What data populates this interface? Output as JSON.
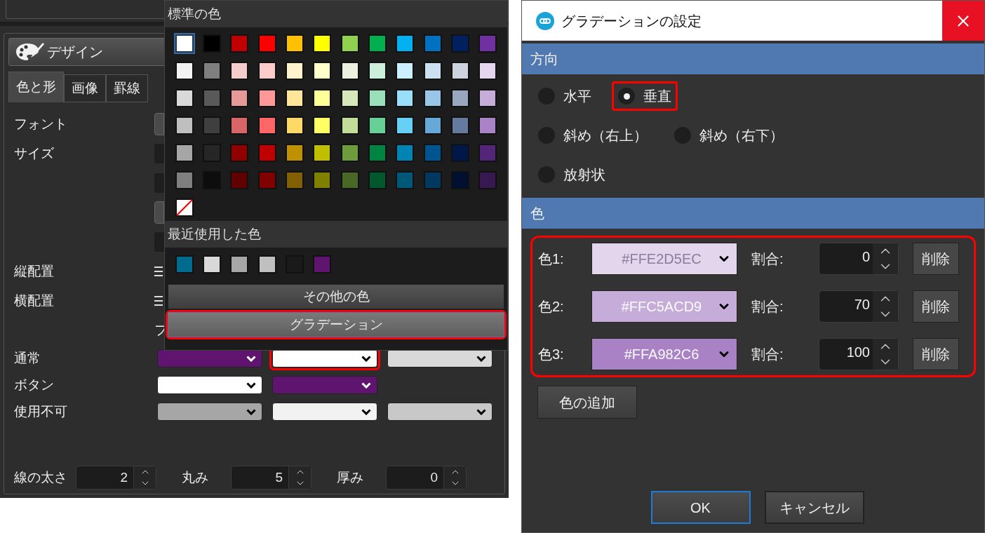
{
  "design_panel": {
    "title": "デザイン",
    "tabs": [
      {
        "label": "色と形",
        "selected": true
      },
      {
        "label": "画像",
        "selected": false
      },
      {
        "label": "罫線",
        "selected": false
      }
    ],
    "property_rows": [
      {
        "label": "フォント",
        "kind": "button-edge"
      },
      {
        "label": "サイズ",
        "kind": "field-edge"
      },
      {
        "kind": "field-edge"
      },
      {
        "kind": "button-edge"
      },
      {
        "kind": "field-edge"
      },
      {
        "label": "縦配置",
        "kind": "align-icon"
      },
      {
        "label": "横配置",
        "kind": "align-icon"
      },
      {
        "kind": "text-edge",
        "text": "フ"
      }
    ],
    "color_rows": [
      {
        "label": "通常",
        "dropdowns": [
          {
            "color": "#5f1470"
          },
          {
            "color": "#ffffff",
            "highlighted": true
          },
          {
            "color": "#d9d9d9"
          }
        ]
      },
      {
        "label": "ボタン",
        "dropdowns": [
          {
            "color": "#ffffff"
          },
          {
            "color": "#5f1470"
          }
        ]
      },
      {
        "label": "使用不可",
        "dropdowns": [
          {
            "color": "#a6a6a6"
          },
          {
            "color": "#f2f2f2"
          },
          {
            "color": "#c8c8c8"
          }
        ]
      }
    ],
    "spinners": [
      {
        "label": "線の太さ",
        "value": "2"
      },
      {
        "label": "丸み",
        "value": "5"
      },
      {
        "label": "厚み",
        "value": "0"
      }
    ]
  },
  "color_popup": {
    "standard_title": "標準の色",
    "swatches": [
      {
        "kind": "color",
        "color": "#ffffff",
        "selected": true
      },
      {
        "kind": "color",
        "color": "#000000",
        "selected": false
      },
      {
        "kind": "color",
        "color": "#c00000",
        "selected": false
      },
      {
        "kind": "color",
        "color": "#ff0000",
        "selected": false
      },
      {
        "kind": "color",
        "color": "#ffc000",
        "selected": false
      },
      {
        "kind": "color",
        "color": "#ffff00",
        "selected": false
      },
      {
        "kind": "color",
        "color": "#92d050",
        "selected": false
      },
      {
        "kind": "color",
        "color": "#00b050",
        "selected": false
      },
      {
        "kind": "color",
        "color": "#00b0f0",
        "selected": false
      },
      {
        "kind": "color",
        "color": "#0070c0",
        "selected": false
      },
      {
        "kind": "color",
        "color": "#002060",
        "selected": false
      },
      {
        "kind": "color",
        "color": "#7030a0",
        "selected": false
      },
      {
        "kind": "color",
        "color": "#f2f2f2",
        "selected": false
      },
      {
        "kind": "color",
        "color": "#7f7f7f",
        "selected": false
      },
      {
        "kind": "color",
        "color": "#f4cccc",
        "selected": false
      },
      {
        "kind": "color",
        "color": "#ffcccc",
        "selected": false
      },
      {
        "kind": "color",
        "color": "#fff2cc",
        "selected": false
      },
      {
        "kind": "color",
        "color": "#ffffcc",
        "selected": false
      },
      {
        "kind": "color",
        "color": "#ebf1de",
        "selected": false
      },
      {
        "kind": "color",
        "color": "#ccefdc",
        "selected": false
      },
      {
        "kind": "color",
        "color": "#ccefff",
        "selected": false
      },
      {
        "kind": "color",
        "color": "#cce0f2",
        "selected": false
      },
      {
        "kind": "color",
        "color": "#ccd2de",
        "selected": false
      },
      {
        "kind": "color",
        "color": "#e3d6ee",
        "selected": false
      },
      {
        "kind": "color",
        "color": "#d9d9d9",
        "selected": false
      },
      {
        "kind": "color",
        "color": "#595959",
        "selected": false
      },
      {
        "kind": "color",
        "color": "#e69999",
        "selected": false
      },
      {
        "kind": "color",
        "color": "#ff9999",
        "selected": false
      },
      {
        "kind": "color",
        "color": "#ffe699",
        "selected": false
      },
      {
        "kind": "color",
        "color": "#ffff99",
        "selected": false
      },
      {
        "kind": "color",
        "color": "#d6e8bb",
        "selected": false
      },
      {
        "kind": "color",
        "color": "#99dfb9",
        "selected": false
      },
      {
        "kind": "color",
        "color": "#99dff9",
        "selected": false
      },
      {
        "kind": "color",
        "color": "#99c6e6",
        "selected": false
      },
      {
        "kind": "color",
        "color": "#99a6bf",
        "selected": false
      },
      {
        "kind": "color",
        "color": "#c6acd9",
        "selected": false
      },
      {
        "kind": "color",
        "color": "#bfbfbf",
        "selected": false
      },
      {
        "kind": "color",
        "color": "#3f3f3f",
        "selected": false
      },
      {
        "kind": "color",
        "color": "#d96666",
        "selected": false
      },
      {
        "kind": "color",
        "color": "#ff6666",
        "selected": false
      },
      {
        "kind": "color",
        "color": "#ffd966",
        "selected": false
      },
      {
        "kind": "color",
        "color": "#ffff66",
        "selected": false
      },
      {
        "kind": "color",
        "color": "#c2dc9a",
        "selected": false
      },
      {
        "kind": "color",
        "color": "#66d096",
        "selected": false
      },
      {
        "kind": "color",
        "color": "#66d0f6",
        "selected": false
      },
      {
        "kind": "color",
        "color": "#66a9d9",
        "selected": false
      },
      {
        "kind": "color",
        "color": "#667a9f",
        "selected": false
      },
      {
        "kind": "color",
        "color": "#a983c6",
        "selected": false
      },
      {
        "kind": "color",
        "color": "#a6a6a6",
        "selected": false
      },
      {
        "kind": "color",
        "color": "#262626",
        "selected": false
      },
      {
        "kind": "color",
        "color": "#900000",
        "selected": false
      },
      {
        "kind": "color",
        "color": "#bf0000",
        "selected": false
      },
      {
        "kind": "color",
        "color": "#bf9000",
        "selected": false
      },
      {
        "kind": "color",
        "color": "#bfbf00",
        "selected": false
      },
      {
        "kind": "color",
        "color": "#6e9c3c",
        "selected": false
      },
      {
        "kind": "color",
        "color": "#008442",
        "selected": false
      },
      {
        "kind": "color",
        "color": "#0084b4",
        "selected": false
      },
      {
        "kind": "color",
        "color": "#005490",
        "selected": false
      },
      {
        "kind": "color",
        "color": "#001848",
        "selected": false
      },
      {
        "kind": "color",
        "color": "#542478",
        "selected": false
      },
      {
        "kind": "color",
        "color": "#7f7f7f",
        "selected": false
      },
      {
        "kind": "color",
        "color": "#0d0d0d",
        "selected": false
      },
      {
        "kind": "color",
        "color": "#600000",
        "selected": false
      },
      {
        "kind": "color",
        "color": "#800000",
        "selected": false
      },
      {
        "kind": "color",
        "color": "#806000",
        "selected": false
      },
      {
        "kind": "color",
        "color": "#808000",
        "selected": false
      },
      {
        "kind": "color",
        "color": "#496828",
        "selected": false
      },
      {
        "kind": "color",
        "color": "#00582c",
        "selected": false
      },
      {
        "kind": "color",
        "color": "#005878",
        "selected": false
      },
      {
        "kind": "color",
        "color": "#003860",
        "selected": false
      },
      {
        "kind": "color",
        "color": "#001030",
        "selected": false
      },
      {
        "kind": "color",
        "color": "#381850",
        "selected": false
      },
      {
        "kind": "none",
        "selected": false
      }
    ],
    "recent_title": "最近使用した色",
    "recent": [
      {
        "color": "#006b8f"
      },
      {
        "color": "#d9d9d9"
      },
      {
        "color": "#a6a6a6"
      },
      {
        "color": "#c0c0c0"
      },
      {
        "color": "#1a1a1a"
      },
      {
        "color": "#5f1470"
      }
    ],
    "buttons": [
      {
        "label": "その他の色",
        "highlighted": false
      },
      {
        "label": "グラデーション",
        "highlighted": true
      }
    ]
  },
  "dialog": {
    "title": "グラデーションの設定",
    "direction_title": "方向",
    "directions": [
      [
        {
          "label": "水平",
          "selected": false
        },
        {
          "label": "垂直",
          "selected": true,
          "highlighted": true
        }
      ],
      [
        {
          "label": "斜め（右上）",
          "selected": false
        },
        {
          "label": "斜め（右下）",
          "selected": false
        }
      ],
      [
        {
          "label": "放射状",
          "selected": false
        }
      ]
    ],
    "color_title": "色",
    "stops_highlighted": true,
    "stops": [
      {
        "label": "色1:",
        "value": "#FFE2D5EC",
        "color": "#e2d5ec",
        "ratio_label": "割合:",
        "ratio": "0",
        "delete": "削除"
      },
      {
        "label": "色2:",
        "value": "#FFC5ACD9",
        "color": "#c5acd9",
        "ratio_label": "割合:",
        "ratio": "70",
        "delete": "削除"
      },
      {
        "label": "色3:",
        "value": "#FFA982C6",
        "color": "#a982c6",
        "ratio_label": "割合:",
        "ratio": "100",
        "delete": "削除"
      }
    ],
    "add_button": "色の追加",
    "buttons": [
      {
        "label": "OK",
        "focused": true
      },
      {
        "label": "キャンセル",
        "focused": false
      }
    ]
  }
}
